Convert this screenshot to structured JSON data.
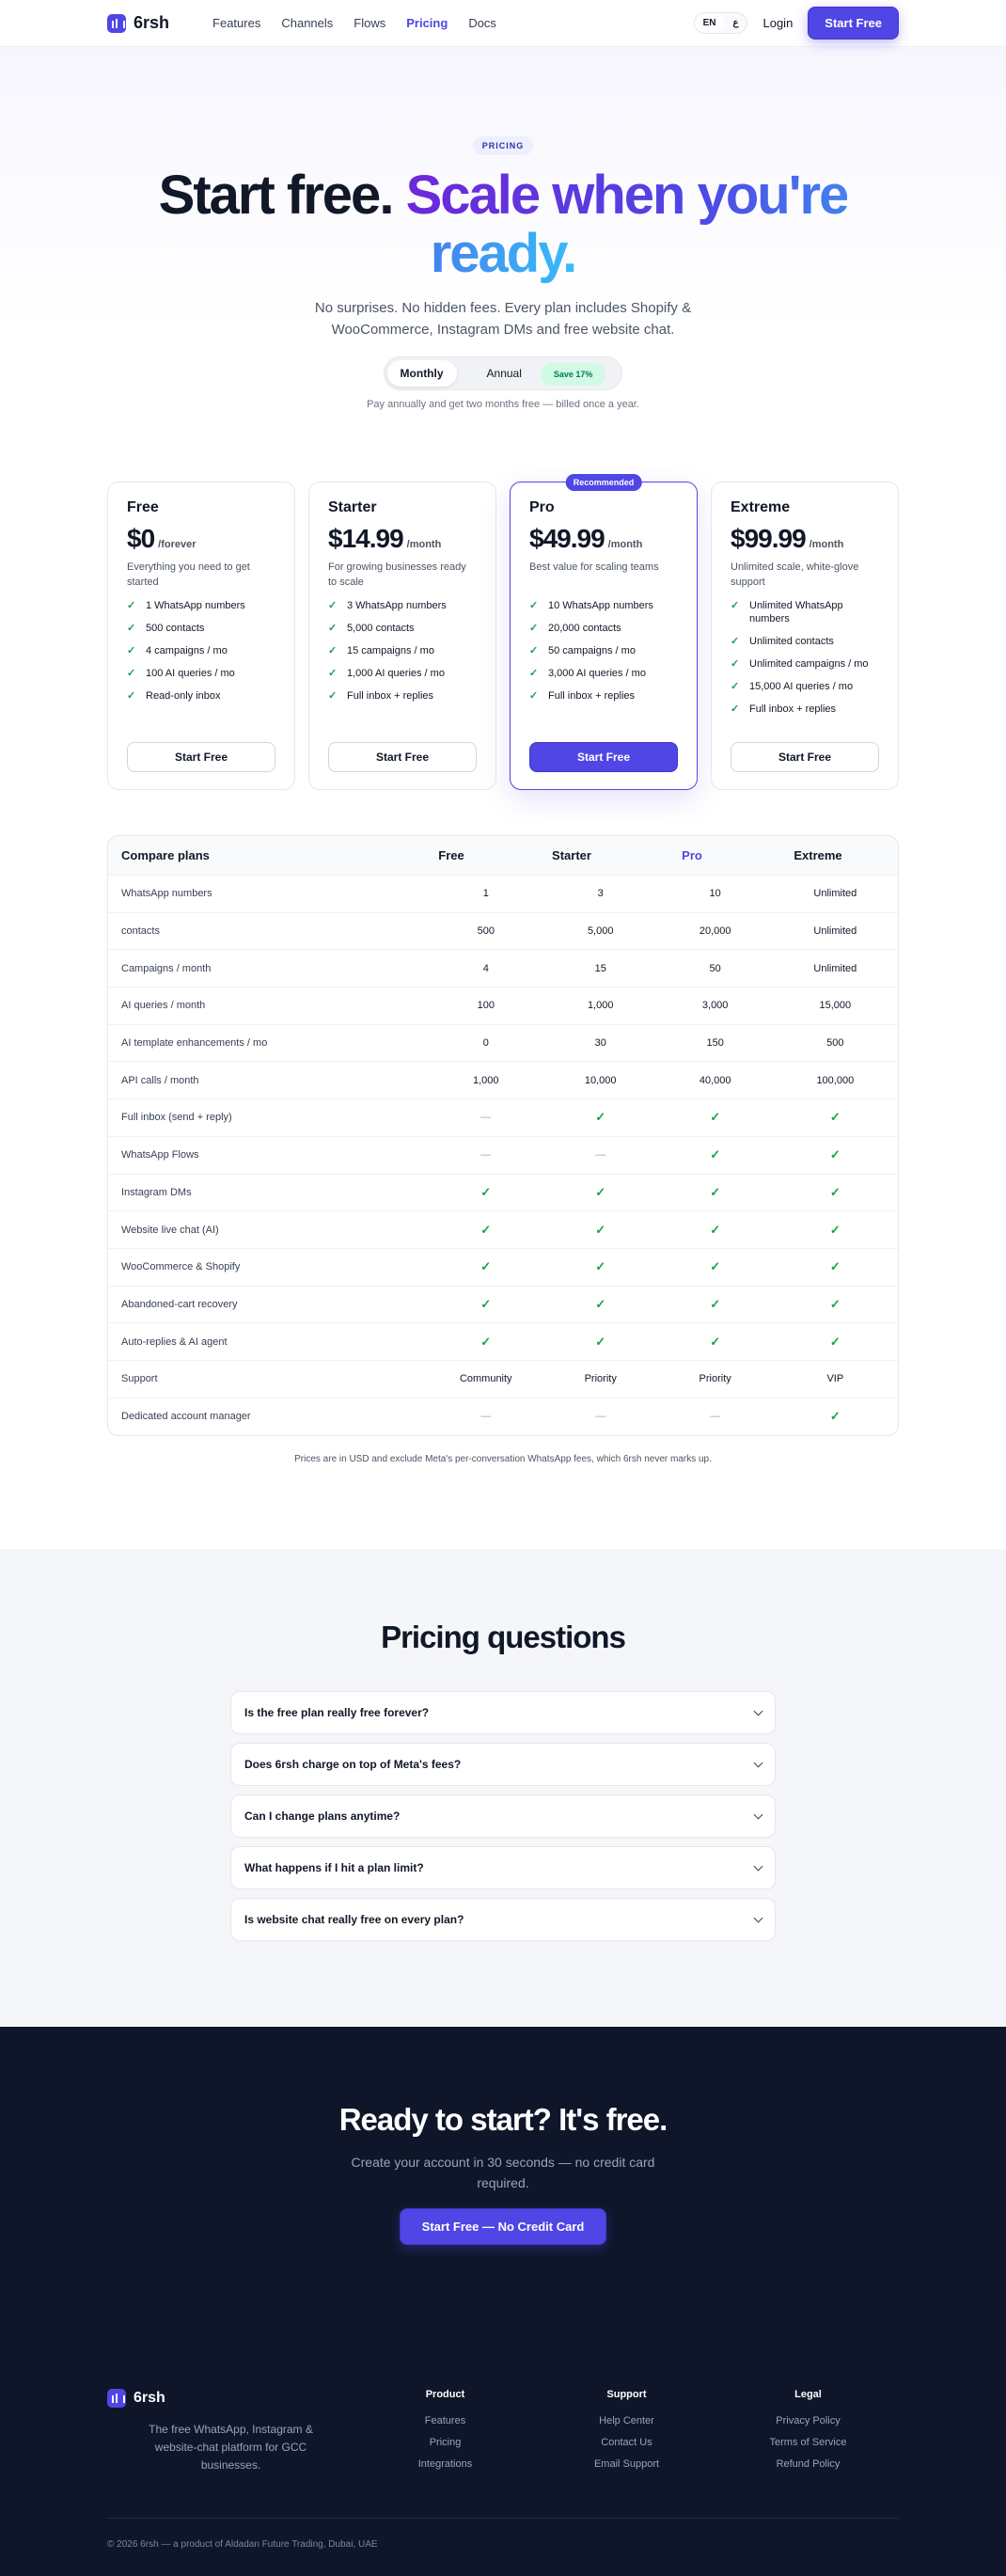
{
  "header": {
    "brand": "6rsh",
    "nav": [
      "Features",
      "Channels",
      "Flows",
      "Pricing",
      "Docs"
    ],
    "active_nav": "Pricing",
    "lang_en": "EN",
    "lang_ar": "ع",
    "login": "Login",
    "cta": "Start Free"
  },
  "hero": {
    "badge": "PRICING",
    "title_dark": "Start free.",
    "title_grad": "Scale when you're ready.",
    "subtitle": "No surprises. No hidden fees. Every plan includes Shopify & WooCommerce, Instagram DMs and free website chat.",
    "toggle_monthly": "Monthly",
    "toggle_annual": "Annual",
    "save_badge": "Save 17%",
    "note": "Pay annually and get two months free — billed once a year."
  },
  "plans": [
    {
      "name": "Free",
      "price": "$0",
      "period": "/forever",
      "desc": "Everything you need to get started",
      "features": [
        "1 WhatsApp numbers",
        "500 contacts",
        "4 campaigns / mo",
        "100 AI queries / mo",
        "Read-only inbox"
      ],
      "button": "Start Free"
    },
    {
      "name": "Starter",
      "price": "$14.99",
      "period": "/month",
      "desc": "For growing businesses ready to scale",
      "features": [
        "3 WhatsApp numbers",
        "5,000 contacts",
        "15 campaigns / mo",
        "1,000 AI queries / mo",
        "Full inbox + replies"
      ],
      "button": "Start Free"
    },
    {
      "name": "Pro",
      "price": "$49.99",
      "period": "/month",
      "desc": "Best value for scaling teams",
      "features": [
        "10 WhatsApp numbers",
        "20,000 contacts",
        "50 campaigns / mo",
        "3,000 AI queries / mo",
        "Full inbox + replies"
      ],
      "button": "Start Free",
      "badge": "Recommended"
    },
    {
      "name": "Extreme",
      "price": "$99.99",
      "period": "/month",
      "desc": "Unlimited scale, white-glove support",
      "features": [
        "Unlimited WhatsApp numbers",
        "Unlimited contacts",
        "Unlimited campaigns / mo",
        "15,000 AI queries / mo",
        "Full inbox + replies"
      ],
      "button": "Start Free"
    }
  ],
  "compare": {
    "title": "Compare plans",
    "columns": [
      "Free",
      "Starter",
      "Pro",
      "Extreme"
    ],
    "rows": [
      {
        "label": "WhatsApp numbers",
        "values": [
          "1",
          "3",
          "10",
          "Unlimited"
        ]
      },
      {
        "label": "contacts",
        "values": [
          "500",
          "5,000",
          "20,000",
          "Unlimited"
        ]
      },
      {
        "label": "Campaigns / month",
        "values": [
          "4",
          "15",
          "50",
          "Unlimited"
        ]
      },
      {
        "label": "AI queries / month",
        "values": [
          "100",
          "1,000",
          "3,000",
          "15,000"
        ]
      },
      {
        "label": "AI template enhancements / mo",
        "values": [
          "0",
          "30",
          "150",
          "500"
        ]
      },
      {
        "label": "API calls / month",
        "values": [
          "1,000",
          "10,000",
          "40,000",
          "100,000"
        ]
      },
      {
        "label": "Full inbox (send + reply)",
        "values": [
          "—",
          "✓",
          "✓",
          "✓"
        ]
      },
      {
        "label": "WhatsApp Flows",
        "values": [
          "—",
          "—",
          "✓",
          "✓"
        ]
      },
      {
        "label": "Instagram DMs",
        "values": [
          "✓",
          "✓",
          "✓",
          "✓"
        ]
      },
      {
        "label": "Website live chat (AI)",
        "values": [
          "✓",
          "✓",
          "✓",
          "✓"
        ]
      },
      {
        "label": "WooCommerce & Shopify",
        "values": [
          "✓",
          "✓",
          "✓",
          "✓"
        ]
      },
      {
        "label": "Abandoned-cart recovery",
        "values": [
          "✓",
          "✓",
          "✓",
          "✓"
        ]
      },
      {
        "label": "Auto-replies & AI agent",
        "values": [
          "✓",
          "✓",
          "✓",
          "✓"
        ]
      },
      {
        "label": "Support",
        "values": [
          "Community",
          "Priority",
          "Priority",
          "VIP"
        ]
      },
      {
        "label": "Dedicated account manager",
        "values": [
          "—",
          "—",
          "—",
          "✓"
        ]
      }
    ],
    "disclaimer": "Prices are in USD and exclude Meta's per-conversation WhatsApp fees, which 6rsh never marks up."
  },
  "faq": {
    "title": "Pricing questions",
    "items": [
      "Is the free plan really free forever?",
      "Does 6rsh charge on top of Meta's fees?",
      "Can I change plans anytime?",
      "What happens if I hit a plan limit?",
      "Is website chat really free on every plan?"
    ]
  },
  "cta": {
    "title": "Ready to start? It's free.",
    "subtitle": "Create your account in 30 seconds — no credit card required.",
    "button": "Start Free — No Credit Card"
  },
  "footer": {
    "brand": "6rsh",
    "tagline": "The free WhatsApp, Instagram & website-chat platform for GCC businesses.",
    "columns": [
      {
        "title": "Product",
        "links": [
          "Features",
          "Pricing",
          "Integrations"
        ]
      },
      {
        "title": "Support",
        "links": [
          "Help Center",
          "Contact Us",
          "Email Support"
        ]
      },
      {
        "title": "Legal",
        "links": [
          "Privacy Policy",
          "Terms of Service",
          "Refund Policy"
        ]
      }
    ],
    "copyright": "© 2026 6rsh — a product of Aldadan Future Trading, Dubai, UAE"
  },
  "colors": {
    "accent": "#4f46e5",
    "check": "#16a34a",
    "dark_bg": "#0f1629"
  }
}
